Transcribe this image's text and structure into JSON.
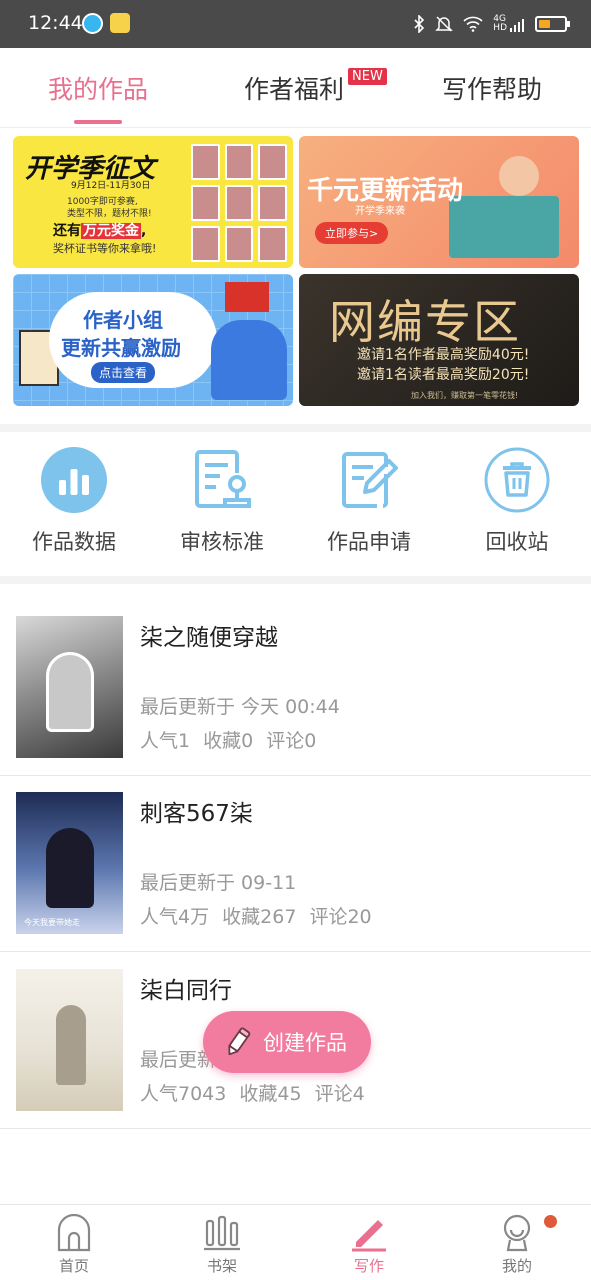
{
  "status_bar": {
    "time": "12:44",
    "network": "4G",
    "network_sub": "HD",
    "battery_level": 0.45,
    "battery_color": "#f5a623"
  },
  "tabs": [
    {
      "label": "我的作品",
      "active": true
    },
    {
      "label": "作者福利",
      "badge": "NEW"
    },
    {
      "label": "写作帮助"
    }
  ],
  "banners": {
    "b1": {
      "title": "开学季征文",
      "date": "9月12日-11月30日",
      "line1": "1000字即可参赛,",
      "line2": "类型不限，题材不限!",
      "big_prefix": "还有",
      "big_highlight": "万元奖金",
      "big_suffix": ",",
      "last": "奖杯证书等你来拿哦!"
    },
    "b2": {
      "title": "千元更新活动",
      "subtitle": "开学季来袭",
      "button": "立即参与>"
    },
    "b3": {
      "line1": "作者小组",
      "line2": "更新共赢激励",
      "button": "点击查看"
    },
    "b4": {
      "title": "网编专区",
      "line1": "邀请1名作者最高奖励40元!",
      "line2": "邀请1名读者最高奖励20元!",
      "footer": "加入我们，赚取第一笔零花钱!"
    }
  },
  "shortcuts": [
    {
      "label": "作品数据",
      "icon": "bar-chart-icon"
    },
    {
      "label": "审核标准",
      "icon": "review-standard-icon"
    },
    {
      "label": "作品申请",
      "icon": "edit-document-icon"
    },
    {
      "label": "回收站",
      "icon": "trash-icon"
    }
  ],
  "works": [
    {
      "title": "柒之随便穿越",
      "updated": "最后更新于 今天 00:44",
      "popularity": "人气1",
      "favorites": "收藏0",
      "comments": "评论0"
    },
    {
      "title": "刺客567柒",
      "updated": "最后更新于 09-11",
      "popularity": "人气4万",
      "favorites": "收藏267",
      "comments": "评论20",
      "cover_caption": "今天我要带她走"
    },
    {
      "title": "柒白同行",
      "updated": "最后更新于",
      "popularity": "人气7043",
      "favorites": "收藏45",
      "comments": "评论4"
    }
  ],
  "fab": {
    "label": "创建作品",
    "icon": "pencil-icon",
    "color": "#f27ba0"
  },
  "bottom_nav": [
    {
      "label": "首页",
      "icon": "home-icon"
    },
    {
      "label": "书架",
      "icon": "bookshelf-icon"
    },
    {
      "label": "写作",
      "icon": "write-icon",
      "active": true
    },
    {
      "label": "我的",
      "icon": "profile-icon",
      "has_notification": true
    }
  ],
  "colors": {
    "accent": "#e9708f",
    "badge": "#e23348",
    "icon_blue": "#7ec3ec"
  }
}
